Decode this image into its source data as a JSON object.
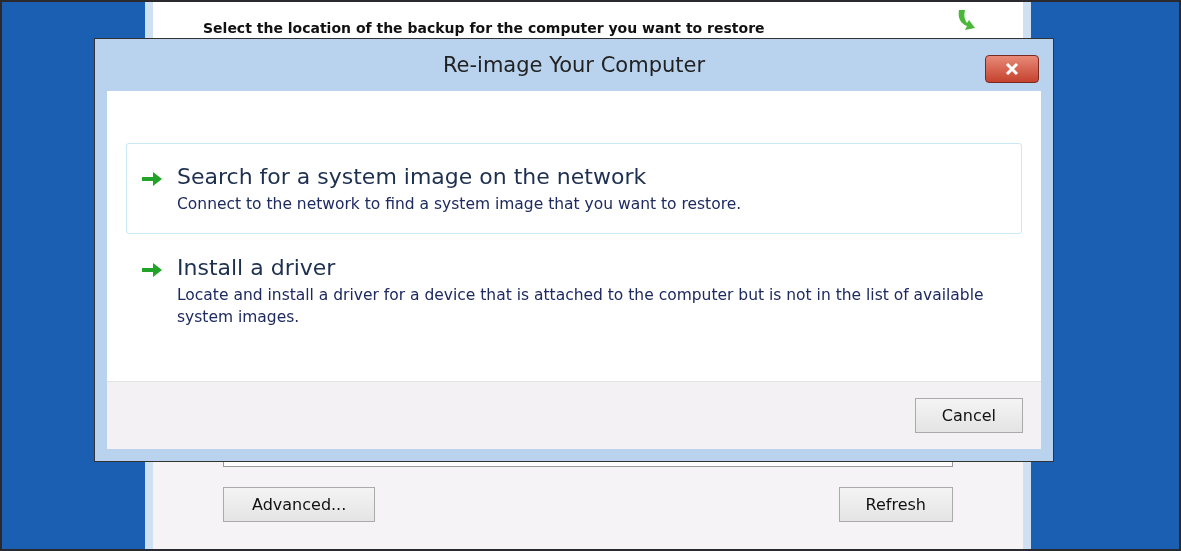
{
  "background_window": {
    "heading": "Select the location of the backup for the computer you want to restore",
    "buttons": [
      "Advanced...",
      "Refresh"
    ]
  },
  "dialog": {
    "title": "Re-image Your Computer",
    "options": [
      {
        "title": "Search for a system image on the network",
        "description": "Connect to the network to find a system image that you want to restore.",
        "selected": true
      },
      {
        "title": "Install a driver",
        "description": "Locate and install a driver for a device that is attached to the computer but is not in the list of available system images.",
        "selected": false
      }
    ],
    "buttons": [
      "Cancel"
    ]
  }
}
